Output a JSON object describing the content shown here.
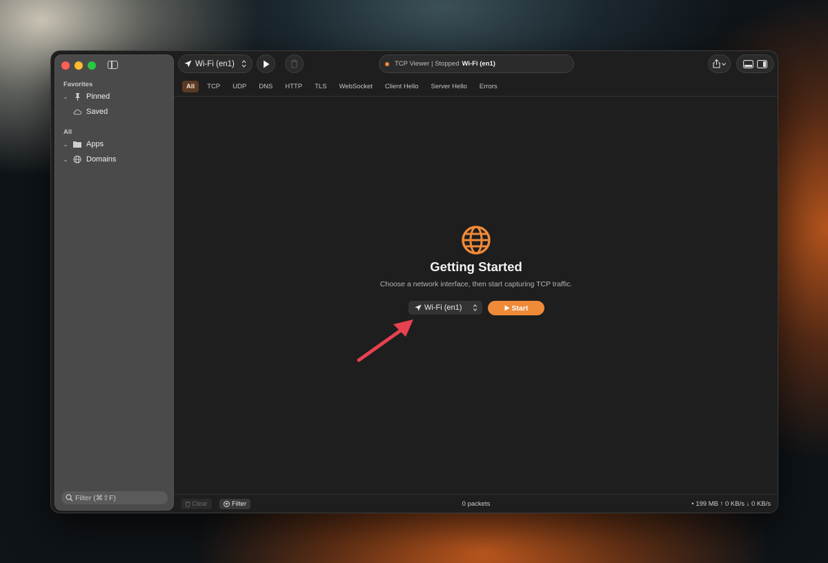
{
  "sidebar": {
    "favorites_label": "Favorites",
    "favorites": [
      {
        "label": "Pinned",
        "icon": "pin-icon"
      },
      {
        "label": "Saved",
        "icon": "cloud-icon"
      }
    ],
    "all_label": "All",
    "all": [
      {
        "label": "Apps",
        "icon": "folder-icon"
      },
      {
        "label": "Domains",
        "icon": "globe-icon"
      }
    ],
    "filter_placeholder": "Filter (⌘⇧F)"
  },
  "toolbar": {
    "interface": "Wi-Fi (en1)",
    "status_app": "TCP Viewer | Stopped",
    "status_interface": "Wi-Fi (en1)",
    "status_color": "#f0883a"
  },
  "tabs": [
    {
      "label": "All",
      "active": true
    },
    {
      "label": "TCP"
    },
    {
      "label": "UDP"
    },
    {
      "label": "DNS"
    },
    {
      "label": "HTTP"
    },
    {
      "label": "TLS"
    },
    {
      "label": "WebSocket"
    },
    {
      "label": "Client Hello"
    },
    {
      "label": "Server Hello"
    },
    {
      "label": "Errors"
    }
  ],
  "main": {
    "title": "Getting Started",
    "subtitle": "Choose a network interface, then start capturing TCP traffic.",
    "interface": "Wi-Fi (en1)",
    "start_label": "Start",
    "accent": "#ef8a38"
  },
  "bottom": {
    "clear_label": "Clear",
    "filter_label": "Filter",
    "packets": "0 packets",
    "stats": "• 199 MB ↑ 0 KB/s ↓ 0 KB/s"
  }
}
